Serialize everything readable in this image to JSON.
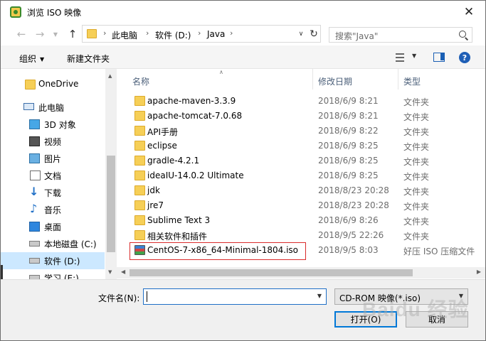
{
  "window": {
    "title": "浏览 ISO 映像"
  },
  "nav": {
    "breadcrumbs": [
      "此电脑",
      "软件 (D:)",
      "Java"
    ],
    "search_placeholder": "搜索\"Java\""
  },
  "toolbar": {
    "organize": "组织",
    "new_folder": "新建文件夹"
  },
  "sidebar": {
    "items": [
      {
        "label": "OneDrive",
        "icon": "folder-icon"
      },
      {
        "label": "此电脑",
        "icon": "computer-icon"
      },
      {
        "label": "3D 对象",
        "icon": "cube-icon"
      },
      {
        "label": "视频",
        "icon": "video-icon"
      },
      {
        "label": "图片",
        "icon": "picture-icon"
      },
      {
        "label": "文档",
        "icon": "document-icon"
      },
      {
        "label": "下载",
        "icon": "download-icon"
      },
      {
        "label": "音乐",
        "icon": "music-icon"
      },
      {
        "label": "桌面",
        "icon": "desktop-icon"
      },
      {
        "label": "本地磁盘 (C:)",
        "icon": "drive-icon"
      },
      {
        "label": "软件 (D:)",
        "icon": "drive-icon",
        "selected": true
      },
      {
        "label": "学习 (E:)",
        "icon": "drive-icon"
      }
    ]
  },
  "columns": {
    "name": "名称",
    "date": "修改日期",
    "type": "类型"
  },
  "files": [
    {
      "name": "apache-maven-3.3.9",
      "date": "2018/6/9 8:21",
      "type": "文件夹"
    },
    {
      "name": "apache-tomcat-7.0.68",
      "date": "2018/6/9 8:21",
      "type": "文件夹"
    },
    {
      "name": "API手册",
      "date": "2018/6/9 8:22",
      "type": "文件夹"
    },
    {
      "name": "eclipse",
      "date": "2018/6/9 8:25",
      "type": "文件夹"
    },
    {
      "name": "gradle-4.2.1",
      "date": "2018/6/9 8:25",
      "type": "文件夹"
    },
    {
      "name": "ideaIU-14.0.2 Ultimate",
      "date": "2018/6/9 8:25",
      "type": "文件夹"
    },
    {
      "name": "jdk",
      "date": "2018/8/23 20:28",
      "type": "文件夹"
    },
    {
      "name": "jre7",
      "date": "2018/8/23 20:28",
      "type": "文件夹"
    },
    {
      "name": "Sublime Text 3",
      "date": "2018/6/9 8:26",
      "type": "文件夹"
    },
    {
      "name": "相关软件和插件",
      "date": "2018/9/5 22:26",
      "type": "文件夹"
    },
    {
      "name": "CentOS-7-x86_64-Minimal-1804.iso",
      "date": "2018/9/5 8:03",
      "type": "好压 ISO 压缩文件"
    }
  ],
  "bottom": {
    "filename_label": "文件名(N):",
    "filename_value": "",
    "filetype": "CD-ROM 映像(*.iso)",
    "open_label": "打开(O)",
    "cancel_label": "取消"
  },
  "watermark": "Baidu 经验",
  "colors": {
    "accent": "#0078d7",
    "highlight": "#d92b2b",
    "selection": "#cce8ff"
  }
}
